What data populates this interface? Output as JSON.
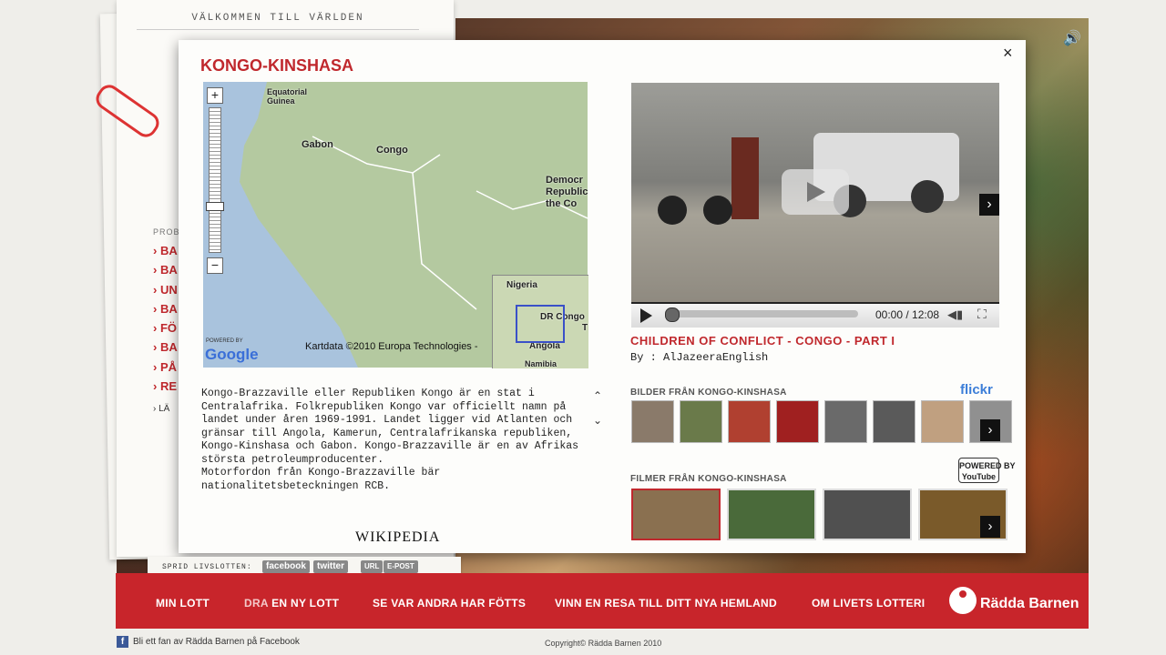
{
  "welcome": "VÄLKOMMEN TILL VÄRLDEN",
  "side_menu": {
    "head": "PROB",
    "items": [
      "› BA",
      "› BA",
      "› UN",
      "› BA",
      "› FÖ",
      "› BA",
      "› PÅ",
      "› RE"
    ],
    "small": "› LÄ"
  },
  "dialog": {
    "title": "KONGO-KINSHASA",
    "close": "×"
  },
  "map": {
    "labels": {
      "eq_guinea": "Equatorial\nGuinea",
      "gabon": "Gabon",
      "congo": "Congo",
      "drc": "Democr\nRepublic\nthe Co",
      "nigeria": "Nigeria",
      "dr_congo": "DR Congo",
      "angola": "Angola",
      "namibia": "Namibia",
      "inset_t": "T"
    },
    "zoom_in": "+",
    "zoom_out": "−",
    "powered": "POWERED BY",
    "google": "Google",
    "credit": "Kartdata ©2010 Europa Technologies -"
  },
  "wiki": {
    "text": "Kongo-Brazzaville eller Republiken Kongo är en stat i Centralafrika. Folkrepubliken Kongo var officiellt namn på landet under åren 1969-1991. Landet ligger vid Atlanten och gränsar till Angola, Kamerun, Centralafrikanska republiken, Kongo-Kinshasa och Gabon. Kongo-Brazzaville är en av Afrikas största petroleumproducenter.\nMotorfordon från Kongo-Brazzaville bär nationalitetsbeteckningen RCB.",
    "logo": "WIKIPEDIA",
    "scroll_up": "⌃",
    "scroll_down": "⌄"
  },
  "video": {
    "time": "00:00 / 12:08",
    "progress": 0,
    "title": "CHILDREN OF CONFLICT - CONGO - PART I",
    "by": "By : AlJazeeraEnglish",
    "next": "›"
  },
  "photos": {
    "label": "BILDER FRÅN KONGO-KINSHASA",
    "source": "flickr",
    "colors": [
      "#8a7a6a",
      "#6a7a4a",
      "#b04030",
      "#a02020",
      "#6a6a6a",
      "#5a5a5a",
      "#c0a080",
      "#909090"
    ],
    "next": "›"
  },
  "films": {
    "label": "FILMER FRÅN KONGO-KINSHASA",
    "source": "POWERED BY\nYouTube",
    "colors": [
      "#8a7050",
      "#4a6a3a",
      "#505050",
      "#7a5a2a"
    ],
    "active_index": 0,
    "next": "›"
  },
  "share": {
    "label": "SPRID LIVSLOTTEN:",
    "buttons": [
      "facebook",
      "twitter",
      "URL",
      "E-POST"
    ]
  },
  "nav": {
    "min_lott": "MIN LOTT",
    "dra_pre": "DRA ",
    "dra_post": "EN NY LOTT",
    "se_var": "SE VAR ANDRA HAR FÖTTS",
    "vinn": "VINN EN RESA TILL DITT NYA HEMLAND",
    "om": "OM LIVETS LOTTERI"
  },
  "brand": "Rädda Barnen",
  "footer": {
    "fb_fan": "Bli ett fan av Rädda Barnen på Facebook",
    "fb_icon": "f",
    "copyright": "Copyright© Rädda Barnen 2010"
  },
  "speaker": "🔊"
}
